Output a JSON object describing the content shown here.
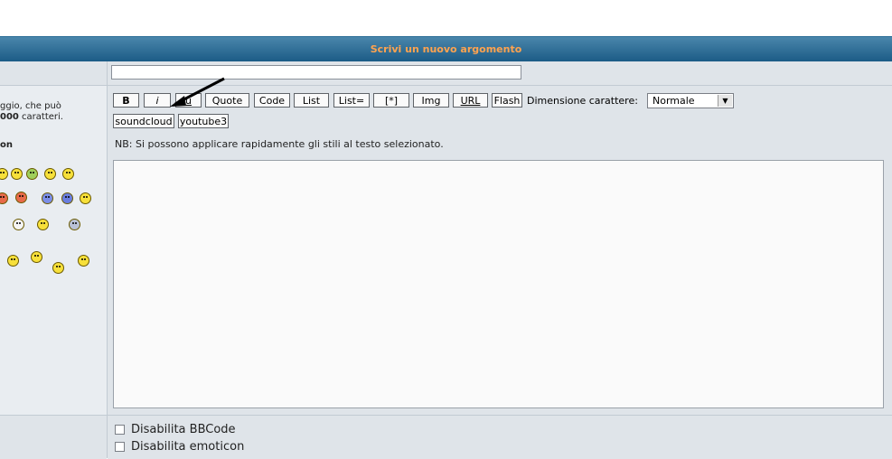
{
  "header": {
    "title": "Scrivi un nuovo argomento"
  },
  "left": {
    "message_text_line1": "ggio, che può",
    "message_text_line2_bold": "000",
    "message_text_line2_rest": " caratteri.",
    "emoticon_heading": "on"
  },
  "subject": {
    "value": ""
  },
  "toolbar": {
    "bold": "B",
    "italic": "i",
    "underline": "u",
    "quote": "Quote",
    "code": "Code",
    "list": "List",
    "list_eq": "List=",
    "list_item": "[*]",
    "img": "Img",
    "url": "URL",
    "flash": "Flash",
    "soundcloud": "soundcloud",
    "youtube": "youtube3",
    "font_size_label": "Dimensione carattere:",
    "font_size_value": "Normale"
  },
  "hint": "NB: Si possono applicare rapidamente gli stili al testo selezionato.",
  "message": {
    "value": ""
  },
  "options": {
    "disable_bbcode": "Disabilita BBCode",
    "disable_emoticon": "Disabilita emoticon"
  },
  "colors": {
    "accent_title": "#ffa34f",
    "bar": "#1a5a85",
    "panel": "#dfe4e9"
  }
}
